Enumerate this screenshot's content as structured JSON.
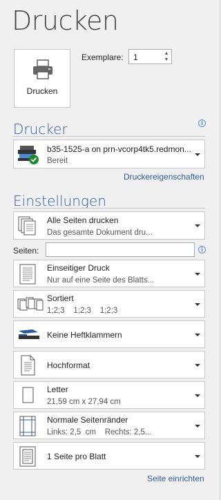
{
  "page": {
    "title": "Drucken"
  },
  "print_button": {
    "label": "Drucken"
  },
  "copies": {
    "label": "Exemplare:",
    "value": "1"
  },
  "printer": {
    "section_title": "Drucker",
    "name": "b35-1525-a on prn-vcorp4tk5.redmon...",
    "status": "Bereit",
    "properties_link": "Druckereigenschaften"
  },
  "settings": {
    "section_title": "Einstellungen",
    "pages_label": "Seiten:",
    "pages_value": "",
    "items": [
      {
        "title": "Alle Seiten drucken",
        "subtitle": "Das gesamte Dokument dru..."
      },
      {
        "title": "Einseitiger Druck",
        "subtitle": "Nur auf eine Seite des Blatts..."
      },
      {
        "title": "Sortiert",
        "subtitle": "1;2;3    1;2;3    1;2;3"
      },
      {
        "title": "Keine Heftklammern",
        "subtitle": ""
      },
      {
        "title": "Hochformat",
        "subtitle": ""
      },
      {
        "title": "Letter",
        "subtitle": "21,59  cm x 27,94  cm"
      },
      {
        "title": "Normale Seitenränder",
        "subtitle": "Links: 2,5  cm    Rechts: 2,5..."
      },
      {
        "title": "1 Seite pro Blatt",
        "subtitle": ""
      }
    ],
    "page_setup_link": "Seite einrichten"
  },
  "colors": {
    "accent": "#2e5c9b",
    "background": "#f0f0f0",
    "ready_check": "#1e8a2e"
  }
}
